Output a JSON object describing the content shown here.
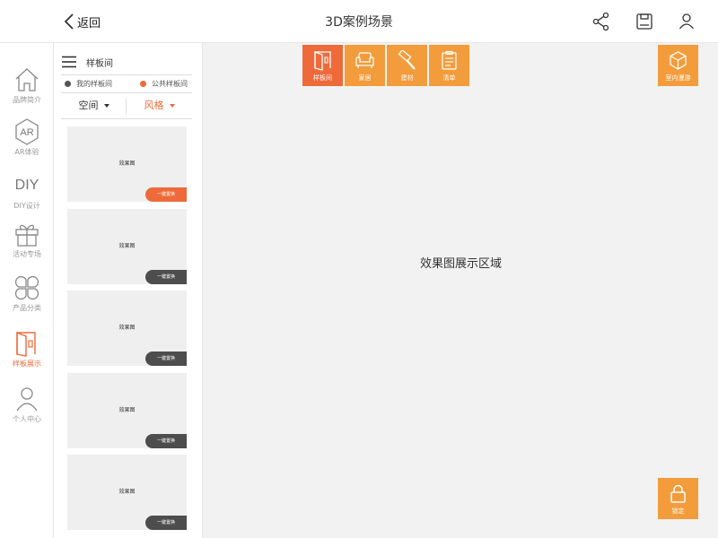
{
  "header": {
    "back_label": "返回",
    "title": "3D案例场景",
    "icons": [
      "share-icon",
      "save-icon",
      "user-icon"
    ]
  },
  "leftnav": {
    "items": [
      {
        "label": "品牌简介",
        "icon": "home-icon"
      },
      {
        "label": "AR体验",
        "icon": "ar-icon",
        "glyph": "AR"
      },
      {
        "label": "DIY设计",
        "icon": "diy-icon",
        "glyph": "DIY"
      },
      {
        "label": "活动专场",
        "icon": "gift-icon"
      },
      {
        "label": "产品分类",
        "icon": "category-icon"
      },
      {
        "label": "样板展示",
        "icon": "door-icon",
        "active": true
      },
      {
        "label": "个人中心",
        "icon": "person-icon"
      }
    ]
  },
  "panel": {
    "title": "样板间",
    "radio_mine": "我的样板间",
    "radio_public": "公共样板间",
    "filter_space": "空间",
    "filter_style": "风格",
    "cards": [
      {
        "caption": "效果图",
        "button": "一键置换",
        "active": true
      },
      {
        "caption": "效果图",
        "button": "一键置换",
        "active": false
      },
      {
        "caption": "效果图",
        "button": "一键置换",
        "active": false
      },
      {
        "caption": "效果图",
        "button": "一键置换",
        "active": false
      },
      {
        "caption": "效果图",
        "button": "一键置换",
        "active": false
      }
    ]
  },
  "toolbar": {
    "items": [
      {
        "label": "样板间",
        "icon": "door-icon",
        "active": true
      },
      {
        "label": "家居",
        "icon": "sofa-icon",
        "active": false
      },
      {
        "label": "建材",
        "icon": "hammer-icon",
        "active": false
      },
      {
        "label": "清单",
        "icon": "list-icon",
        "active": false
      }
    ],
    "tour_label": "室内漫游",
    "lock_label": "锁定"
  },
  "main": {
    "placeholder": "效果图展示区域"
  },
  "colors": {
    "accent": "#ee6a3a",
    "orange": "#f39c3b",
    "dark_button": "#4d4d4d"
  }
}
